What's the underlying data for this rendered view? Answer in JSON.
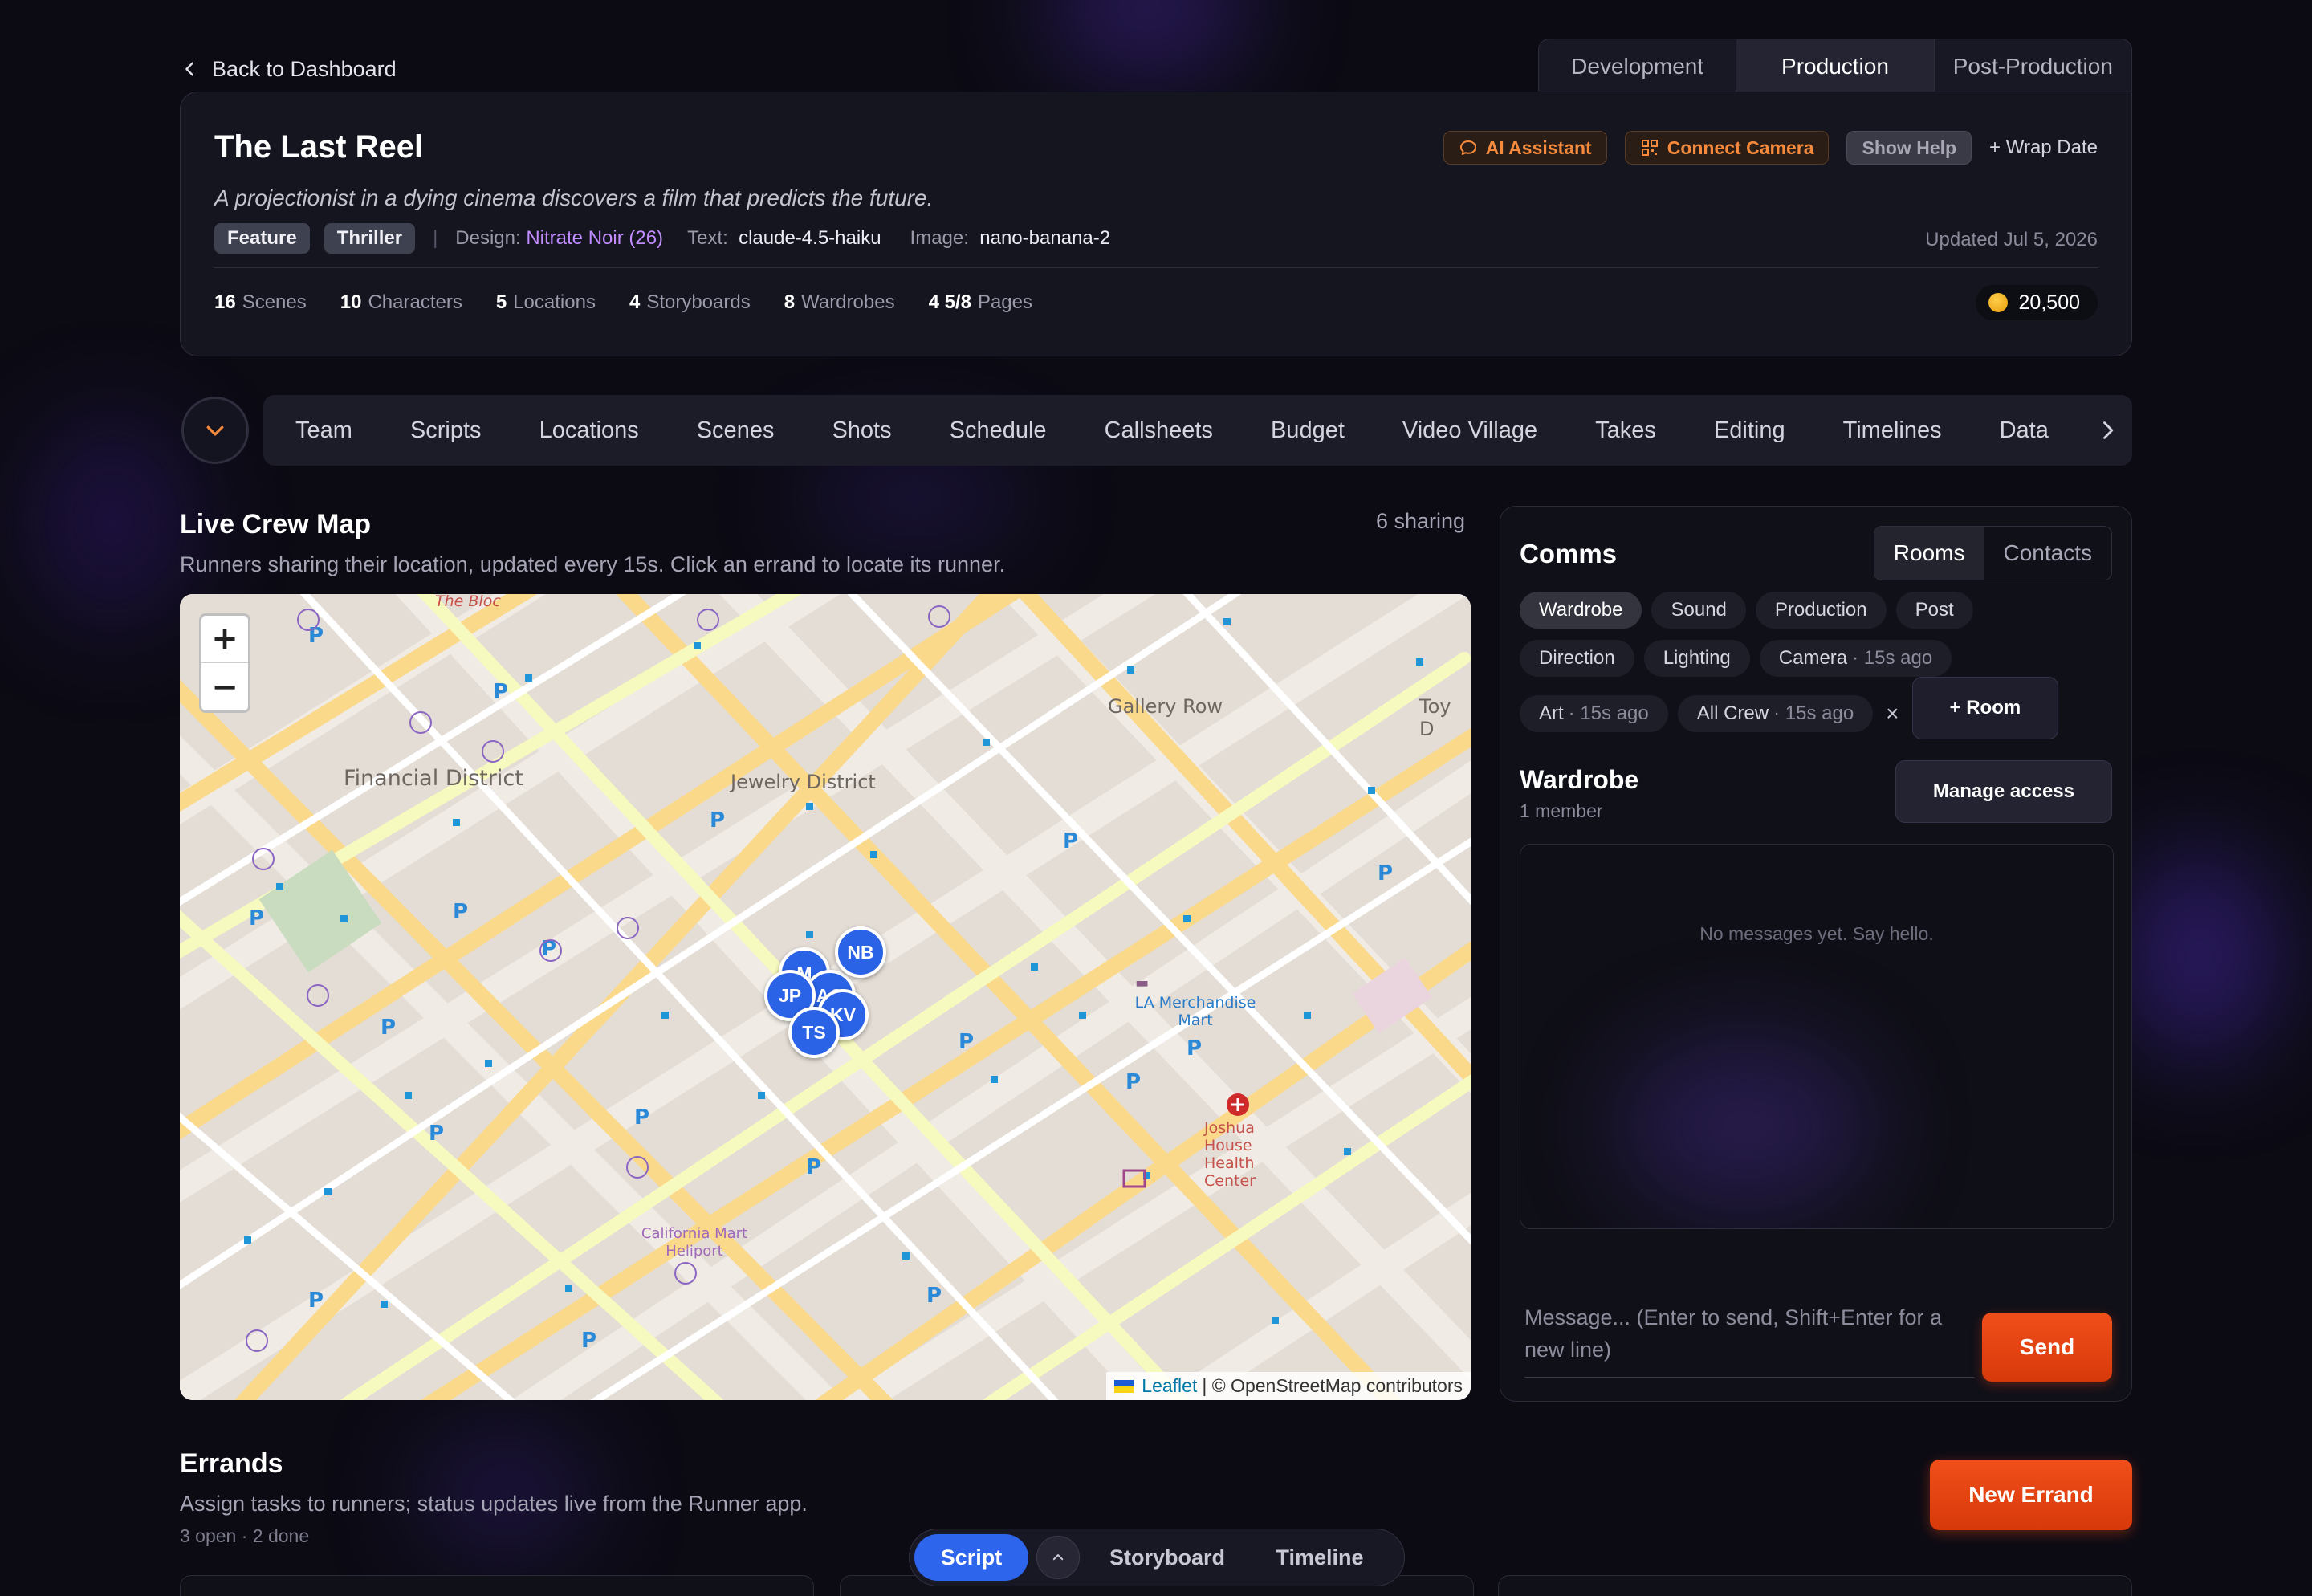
{
  "nav_back": "Back to Dashboard",
  "phases": [
    "Development",
    "Production",
    "Post-Production"
  ],
  "project": {
    "title": "The Last Reel",
    "logline": "A projectionist in a dying cinema discovers a film that predicts the future.",
    "tags": [
      "Feature",
      "Thriller"
    ],
    "design_label": "Design:",
    "design_value": "Nitrate Noir (26)",
    "text_label": "Text:",
    "text_value": "claude-4.5-haiku",
    "image_label": "Image:",
    "image_value": "nano-banana-2",
    "updated": "Updated Jul 5, 2026",
    "actions": {
      "ai": "AI Assistant",
      "camera": "Connect Camera",
      "help": "Show Help",
      "wrap": "+ Wrap Date"
    },
    "stats": [
      {
        "num": "16",
        "label": "Scenes"
      },
      {
        "num": "10",
        "label": "Characters"
      },
      {
        "num": "5",
        "label": "Locations"
      },
      {
        "num": "4",
        "label": "Storyboards"
      },
      {
        "num": "8",
        "label": "Wardrobes"
      },
      {
        "num": "4 5/8",
        "label": "Pages"
      }
    ],
    "credits": "20,500"
  },
  "nav_items": [
    "Team",
    "Scripts",
    "Locations",
    "Scenes",
    "Shots",
    "Schedule",
    "Callsheets",
    "Budget",
    "Video Village",
    "Takes",
    "Editing",
    "Timelines",
    "Data"
  ],
  "crew_map": {
    "title": "Live Crew Map",
    "subtitle": "Runners sharing their location, updated every 15s. Click an errand to locate its runner.",
    "sharing": "6 sharing",
    "zoom_in": "+",
    "zoom_out": "−",
    "attribution_leaflet": "Leaflet",
    "attribution_rest": "| © OpenStreetMap contributors",
    "runners": [
      "NB",
      "JP",
      "KV",
      "TS",
      "M",
      "AO"
    ],
    "labels": {
      "financial": "Financial District",
      "jewelry": "Jewelry District",
      "gallery": "Gallery Row",
      "merch": "LA Merchandise Mart",
      "joshua": "Joshua House Health Center",
      "heliport": "California Mart Heliport",
      "bloc": "The Bloc",
      "toy": "Toy D"
    }
  },
  "comms": {
    "title": "Comms",
    "tabs": [
      "Rooms",
      "Contacts"
    ],
    "rooms_row1": [
      "Wardrobe",
      "Sound",
      "Production",
      "Post"
    ],
    "rooms_row2": [
      {
        "name": "Direction",
        "ago": ""
      },
      {
        "name": "Lighting",
        "ago": ""
      },
      {
        "name": "Camera",
        "ago": "· 15s ago"
      }
    ],
    "rooms_row3": [
      {
        "name": "Art",
        "ago": "· 15s ago"
      },
      {
        "name": "All Crew",
        "ago": "· 15s ago"
      }
    ],
    "remove": "×",
    "add_room": "+ Room",
    "room_title": "Wardrobe",
    "room_members": "1 member",
    "manage": "Manage access",
    "empty": "No messages yet. Say hello.",
    "input_placeholder": "Message... (Enter to send, Shift+Enter for a new line)",
    "send": "Send"
  },
  "errands": {
    "title": "Errands",
    "subtitle": "Assign tasks to runners; status updates live from the Runner app.",
    "count": "3 open · 2 done",
    "new": "New Errand"
  },
  "view_switch": [
    "Script",
    "Storyboard",
    "Timeline"
  ],
  "colors": {
    "accent_orange": "#e8461a",
    "accent_blue": "#2d66ec",
    "design_purple": "#c08cff"
  }
}
